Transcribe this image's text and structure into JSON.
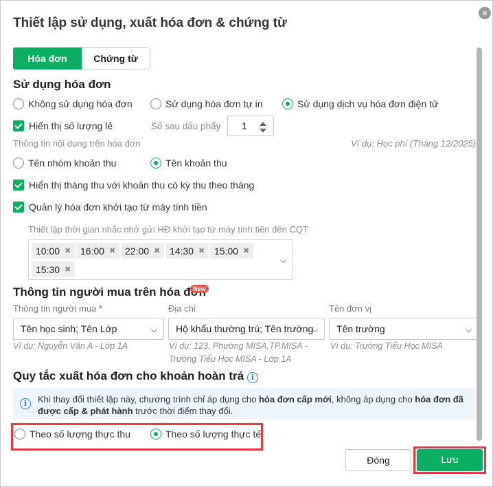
{
  "dialog": {
    "title": "Thiết lập sử dụng, xuất hóa đơn & chứng từ",
    "close_icon": "×"
  },
  "tabs": [
    {
      "label": "Hóa đơn",
      "active": true
    },
    {
      "label": "Chứng từ",
      "active": false
    }
  ],
  "usage": {
    "title": "Sử dụng hóa đơn",
    "options": [
      {
        "label": "Không sử dụng hóa đơn",
        "selected": false
      },
      {
        "label": "Sử dụng hóa đơn tự in",
        "selected": false
      },
      {
        "label": "Sử dụng dịch vụ hóa đơn điện tử",
        "selected": true
      }
    ],
    "show_decimal_qty": {
      "label": "Hiển thị số lượng lẻ",
      "checked": true
    },
    "decimal_places_label": "Số sau dấu phẩy",
    "decimal_places_value": "1",
    "content_info_label": "Thông tin nội dung trên hóa đơn",
    "content_example": "Ví dụ: Học phí (Tháng 12/2025)",
    "content_options": [
      {
        "label": "Tên nhóm khoản thu",
        "selected": false
      },
      {
        "label": "Tên khoản thu",
        "selected": true
      }
    ],
    "show_month": {
      "label": "Hiển thị tháng thu với khoản thu có kỳ thu theo tháng",
      "checked": true
    },
    "pos_manage": {
      "label": "Quản lý hóa đơn khởi tạo từ máy tính tiền",
      "checked": true
    },
    "reminder_label": "Thiết lập thời gian nhắc nhở gửi HĐ khởi tạo từ máy tính tiền đến CQT",
    "reminder_times": [
      "10:00",
      "16:00",
      "22:00",
      "14:30",
      "15:00",
      "15:30"
    ]
  },
  "buyer": {
    "title": "Thông tin người mua trên hóa đơn",
    "new_badge": "New",
    "fields": [
      {
        "label": "Thông tin người mua",
        "required": "*",
        "value": "Tên học sinh; Tên Lớp",
        "example": "Ví dụ: Nguyễn Văn A - Lớp 1A"
      },
      {
        "label": "Địa chỉ",
        "value": "Hộ khẩu thường trú; Tên trường",
        "example_line1": "Ví dụ: 123, Phường MISA,TP.MISA -",
        "example_line2": "Trường Tiểu Học MISA - Lớp 1A"
      },
      {
        "label": "Tên đơn vị",
        "value": "Tên trường",
        "example": "Ví dụ: Trường Tiểu Học MISA"
      }
    ]
  },
  "refund": {
    "title": "Quy tắc xuất hóa đơn cho khoản hoàn trả",
    "notice_prefix": "Khi thay đổi thiết lập này, chương trình chỉ áp dụng cho ",
    "notice_bold1": "hóa đơn cấp mới",
    "notice_mid": ", không áp dụng cho ",
    "notice_bold2": "hóa đơn đã được cấp & phát hành",
    "notice_suffix": " trước thời điểm thay đổi.",
    "options": [
      {
        "label": "Theo số lượng thực thu",
        "selected": false
      },
      {
        "label": "Theo số lượng thực tế",
        "selected": true
      }
    ]
  },
  "footer": {
    "close_label": "Đóng",
    "save_label": "Lưu"
  },
  "colors": {
    "accent": "#0aaf63",
    "highlight": "#e53945",
    "info": "#2a7de1"
  }
}
